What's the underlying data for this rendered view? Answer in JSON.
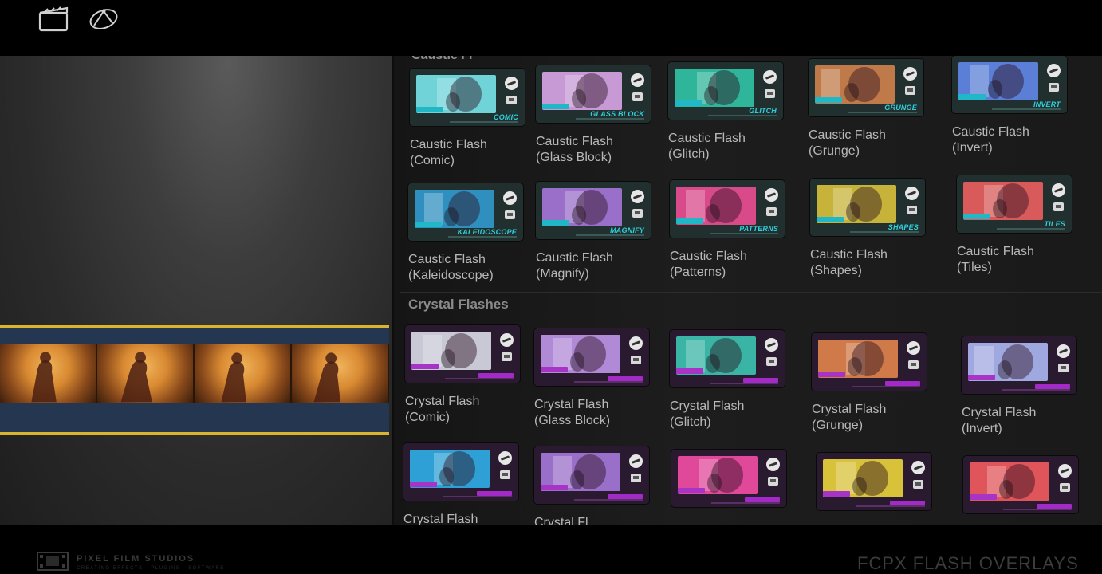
{
  "browser": {
    "cut_header": "Caustic Fl",
    "section_crystal": "Crystal Flashes",
    "caustic_row1": [
      {
        "label": "Caustic Flash (Comic)",
        "style": "COMIC",
        "color": "#6fd3d8"
      },
      {
        "label": "Caustic Flash (Glass Block)",
        "style": "GLASS BLOCK",
        "color": "#c79ad6"
      },
      {
        "label": "Caustic Flash (Glitch)",
        "style": "GLITCH",
        "color": "#2fb59a"
      },
      {
        "label": "Caustic Flash (Grunge)",
        "style": "GRUNGE",
        "color": "#c07a4a"
      },
      {
        "label": "Caustic Flash (Invert)",
        "style": "INVERT",
        "color": "#5b7fd6"
      }
    ],
    "caustic_row2": [
      {
        "label": "Caustic Flash (Kaleidoscope)",
        "style": "KALEIDOSCOPE",
        "color": "#2f8fbf"
      },
      {
        "label": "Caustic Flash (Magnify)",
        "style": "MAGNIFY",
        "color": "#9a6fc9"
      },
      {
        "label": "Caustic Flash (Patterns)",
        "style": "PATTERNS",
        "color": "#d94a8a"
      },
      {
        "label": "Caustic Flash (Shapes)",
        "style": "SHAPES",
        "color": "#c7b23a"
      },
      {
        "label": "Caustic Flash (Tiles)",
        "style": "TILES",
        "color": "#d95a5a"
      }
    ],
    "crystal_row1": [
      {
        "label": "Crystal Flash (Comic)",
        "color": "#c9c9d6"
      },
      {
        "label": "Crystal Flash (Glass Block)",
        "color": "#b08ad6"
      },
      {
        "label": "Crystal Flash (Glitch)",
        "color": "#3ab5a5"
      },
      {
        "label": "Crystal Flash (Grunge)",
        "color": "#d07a4a"
      },
      {
        "label": "Crystal Flash (Invert)",
        "color": "#a0a8e0"
      }
    ],
    "crystal_row2": [
      {
        "label": "Crystal Flash",
        "color": "#2fa0d6"
      },
      {
        "label": "Crystal Fl",
        "color": "#9a6fc9"
      },
      {
        "label": "",
        "color": "#e0489a"
      },
      {
        "label": "",
        "color": "#d8c23a"
      },
      {
        "label": "",
        "color": "#e0555a"
      }
    ]
  },
  "footer": {
    "brand": "PIXEL FILM STUDIOS",
    "brand_sub": "CREATING EFFECTS · PLUGINS · SOFTWARE",
    "product": "FCPX FLASH OVERLAYS"
  },
  "colors": {
    "accent_cyan": "#2fd0dd",
    "accent_purple": "#a733c7",
    "timeline_yellow": "#d8b52d",
    "timeline_blue": "#243650"
  }
}
